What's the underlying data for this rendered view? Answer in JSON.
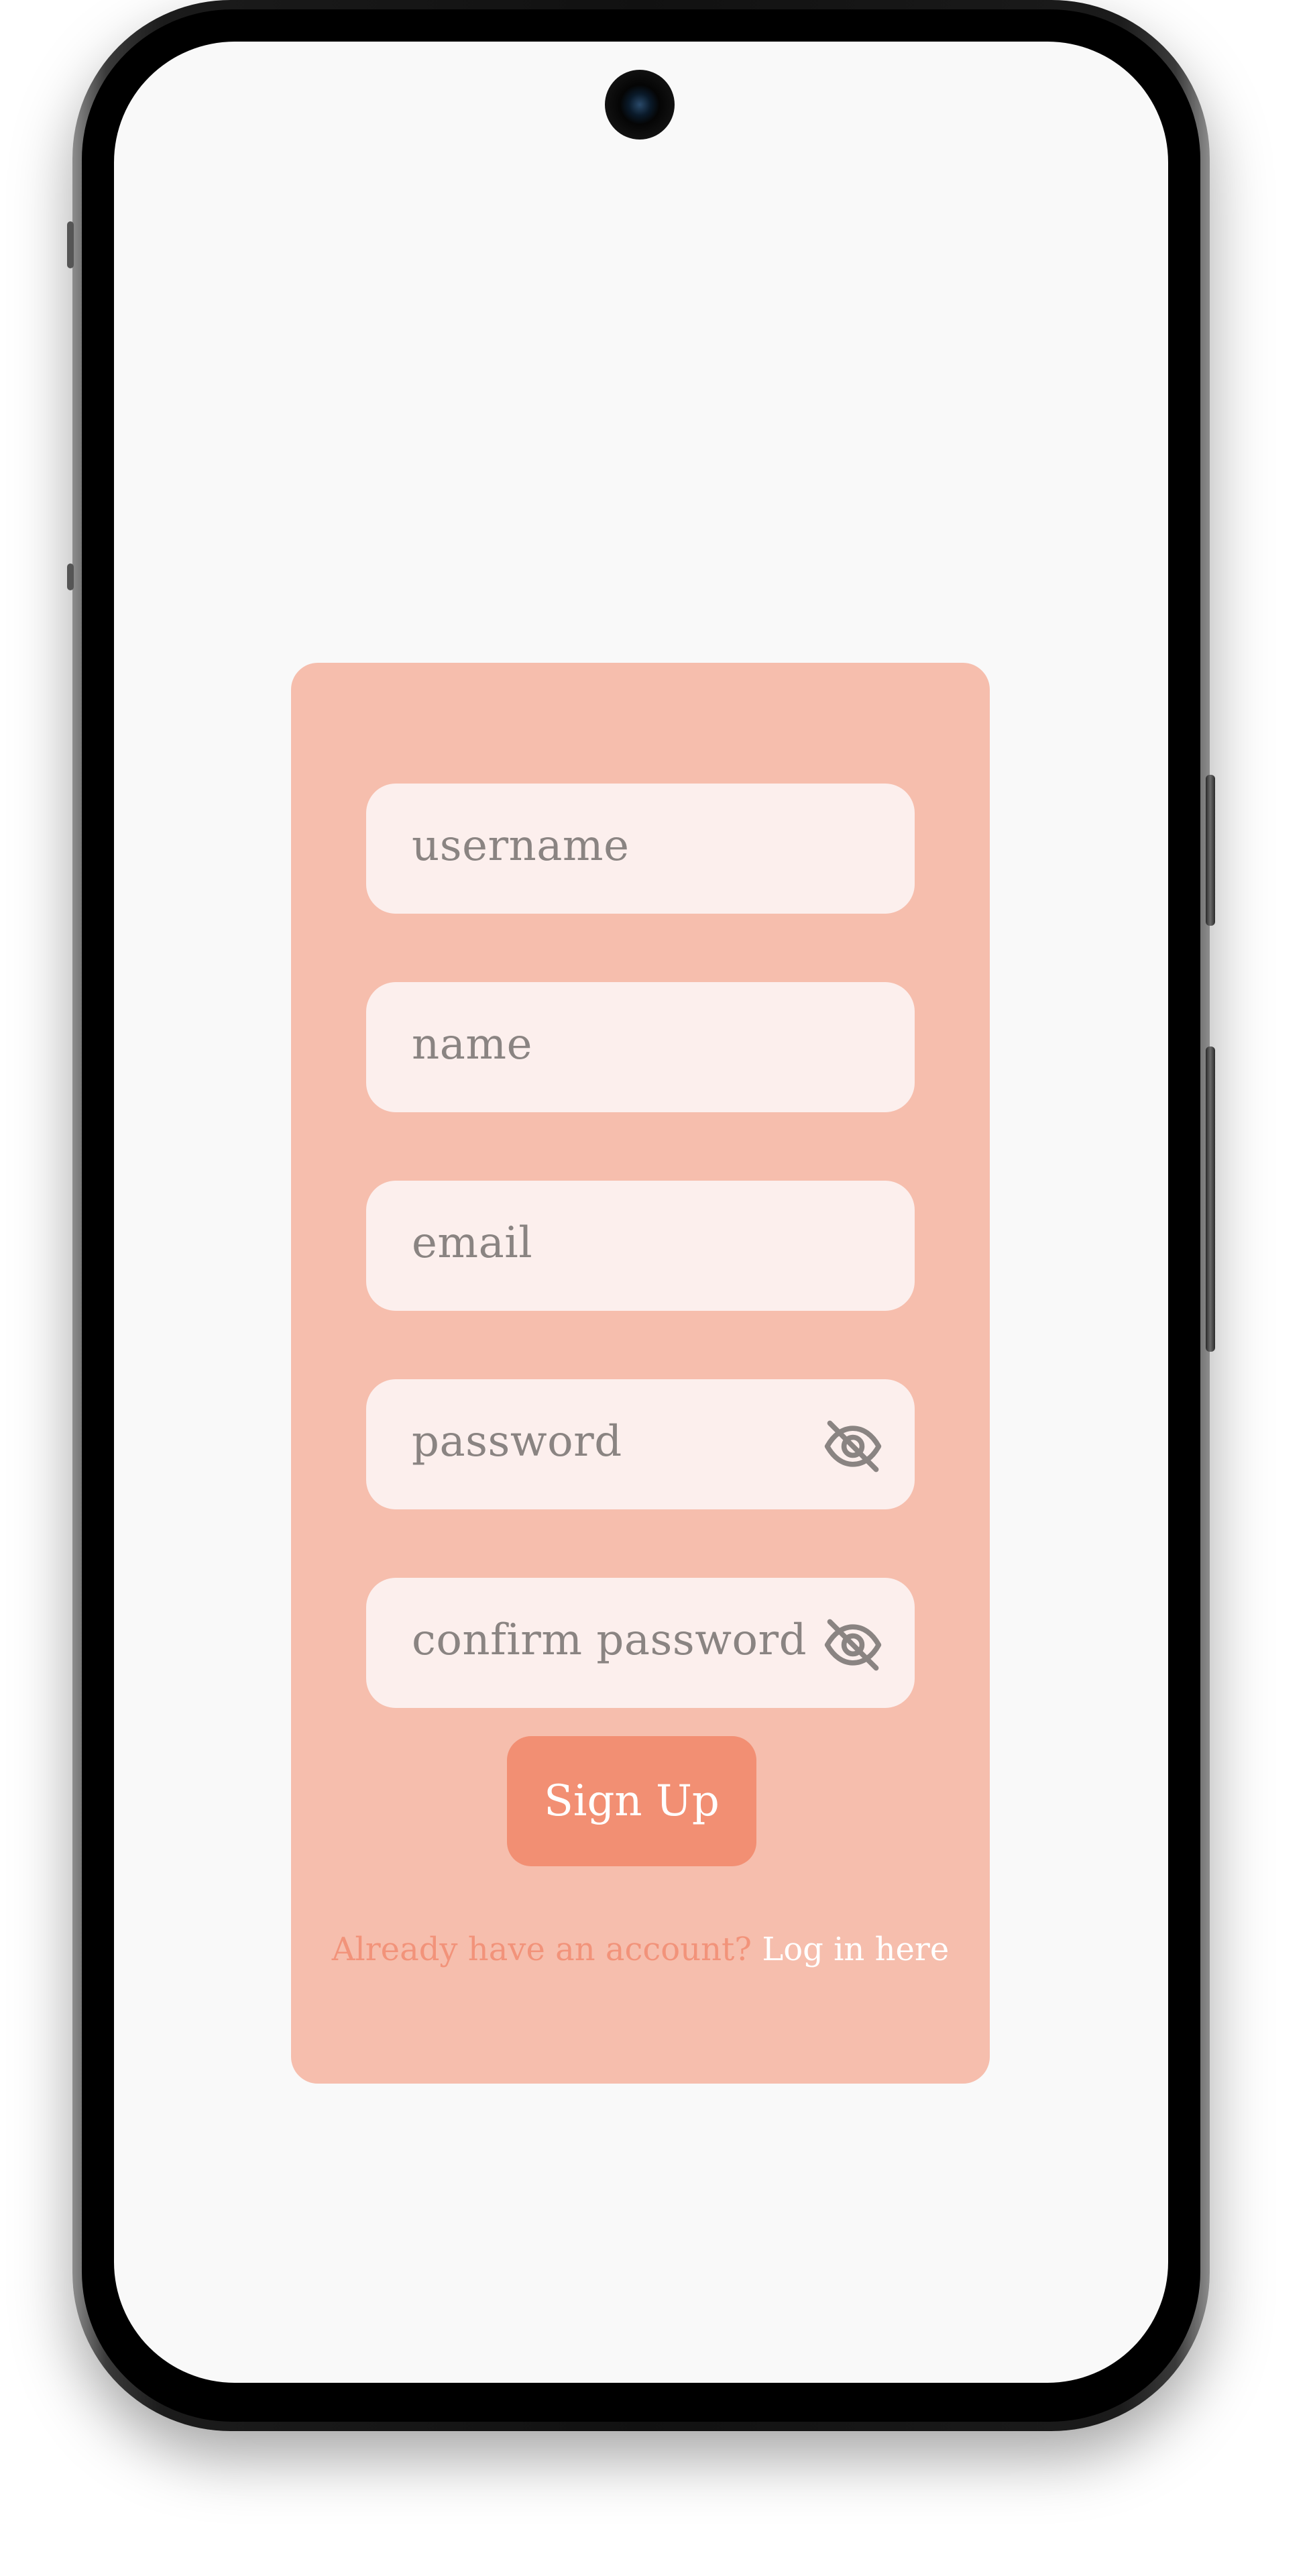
{
  "form": {
    "username_placeholder": "username",
    "name_placeholder": "name",
    "email_placeholder": "email",
    "password_placeholder": "password",
    "confirm_password_placeholder": "confirm password",
    "password_toggle_icon": "eye-off-icon",
    "confirm_password_toggle_icon": "eye-off-icon",
    "submit_label": "Sign Up",
    "login_prompt": "Already  have an account?",
    "login_link": "Log in here"
  },
  "colors": {
    "card_background": "#f6bead",
    "field_background": "#fcefed",
    "button_background": "#f28f73",
    "prompt_text": "#f2937a",
    "link_text": "#ffffff",
    "placeholder_text": "#8a8482",
    "screen_background": "#f9f9f9"
  }
}
